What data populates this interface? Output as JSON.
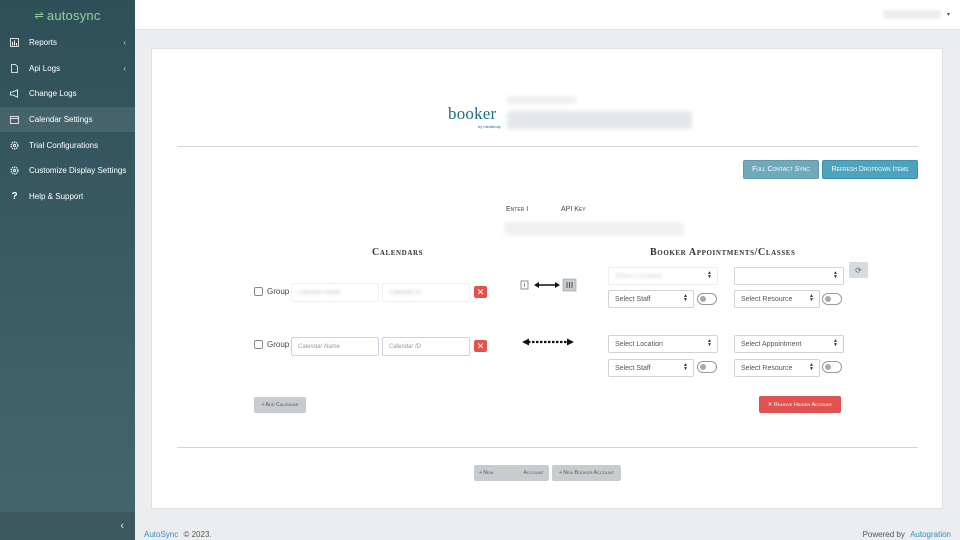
{
  "brand": {
    "name": "autosync",
    "arrows": "⇌"
  },
  "nav": [
    {
      "label": "Reports",
      "chevron": "‹"
    },
    {
      "label": "Api Logs",
      "chevron": "‹"
    },
    {
      "label": "Change Logs",
      "chevron": ""
    },
    {
      "label": "Calendar Settings",
      "chevron": ""
    },
    {
      "label": "Trial Configurations",
      "chevron": ""
    },
    {
      "label": "Customize Display Settings",
      "chevron": ""
    },
    {
      "label": "Help & Support",
      "chevron": ""
    }
  ],
  "active_nav": "Calendar Settings",
  "sidebar_collapse": "‹",
  "header": {
    "caret": "▾"
  },
  "logo": {
    "name": "booker",
    "sub": "by mindbody"
  },
  "buttons": {
    "full_contact_sync": "Full Contact Sync",
    "refresh_dropdown": "Refresh Dropdown Items",
    "add_calendar": "+ Add Calendar",
    "remove_account": "✕ Remove Hidden Account",
    "new_account": "+ New",
    "new_account_suffix": "Account",
    "new_booker_account": "+ New Booker Account"
  },
  "api": {
    "enter_label": "Enter I",
    "api_key_label": "API Key"
  },
  "columns": {
    "calendars": "Calendars",
    "booker": "Booker Appointments/Classes"
  },
  "rows": [
    {
      "group_label": "Group",
      "calendar_name": "Calendar Name",
      "calendar_id": "Calendar ID",
      "select_location": "Select Location",
      "select_appointment": "",
      "select_staff": "Select Staff",
      "select_resource": "Select Resource"
    },
    {
      "group_label": "Group",
      "calendar_name": "Calendar Name",
      "calendar_id": "Calendar ID",
      "select_location": "Select Location",
      "select_appointment": "Select Appointment",
      "select_staff": "Select Staff",
      "select_resource": "Select Resource"
    }
  ],
  "icons": {
    "remove": "✕",
    "refresh": "⟳"
  },
  "footer": {
    "brand_link": "AutoSync",
    "copyright": "© 2023.",
    "powered_by": "Powered by",
    "powered_link": "Autogration"
  },
  "colors": {
    "sidebar": "#2f4f59",
    "accent": "#4ea3bf",
    "danger": "#e0534f",
    "brand_green": "#8fd19e"
  }
}
